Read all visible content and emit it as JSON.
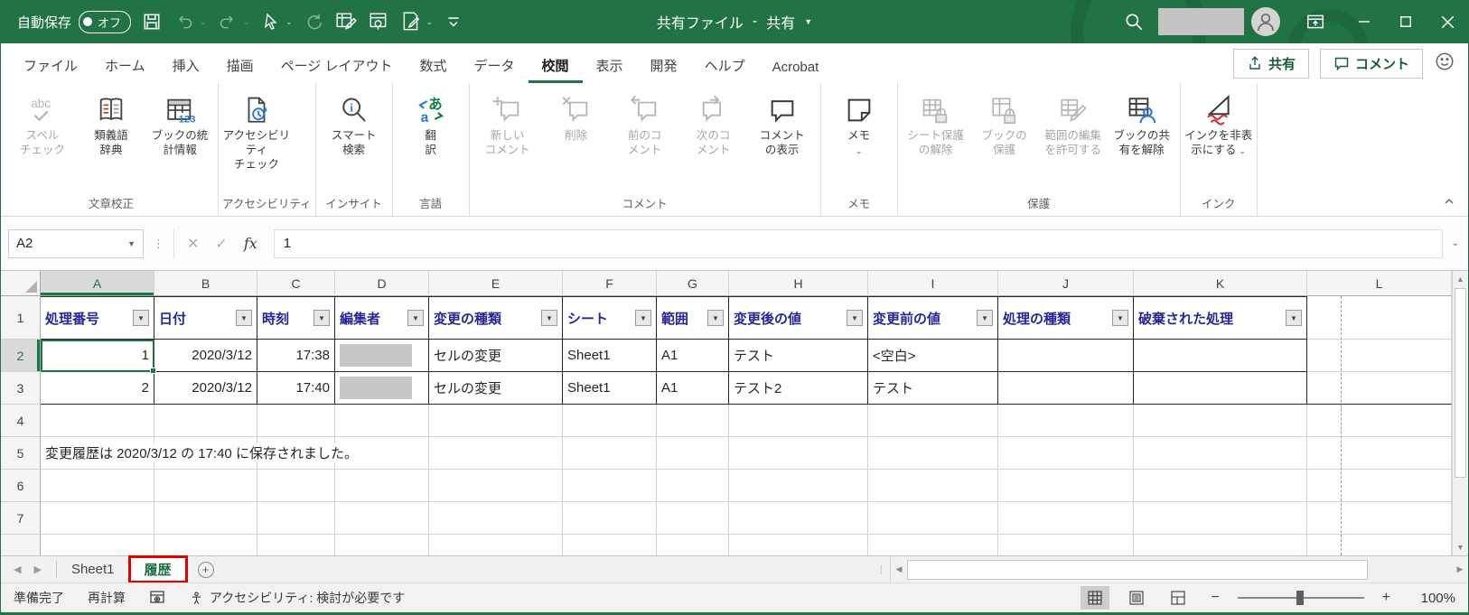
{
  "titlebar": {
    "autosave_label": "自動保存",
    "autosave_state": "オフ",
    "doc_title": "共有ファイル",
    "separator": "-",
    "doc_status": "共有"
  },
  "ribbon": {
    "tabs": [
      "ファイル",
      "ホーム",
      "挿入",
      "描画",
      "ページ レイアウト",
      "数式",
      "データ",
      "校閲",
      "表示",
      "開発",
      "ヘルプ",
      "Acrobat"
    ],
    "active_index": 7,
    "share_label": "共有",
    "comments_label": "コメント",
    "groups": [
      {
        "label": "文章校正",
        "buttons": [
          {
            "name": "spell-check",
            "icon": "spellcheck",
            "label": "スペル\nチェック",
            "disabled": true
          },
          {
            "name": "thesaurus",
            "icon": "book",
            "label": "類義語\n辞典"
          },
          {
            "name": "workbook-stats",
            "icon": "stats",
            "label": "ブックの統\n計情報"
          }
        ]
      },
      {
        "label": "アクセシビリティ",
        "buttons": [
          {
            "name": "accessibility-check",
            "icon": "accessibility",
            "label": "アクセシビリティ\nチェック"
          }
        ]
      },
      {
        "label": "インサイト",
        "buttons": [
          {
            "name": "smart-lookup",
            "icon": "lookup",
            "label": "スマート\n検索"
          }
        ]
      },
      {
        "label": "言語",
        "buttons": [
          {
            "name": "translate",
            "icon": "translate",
            "label": "翻\n訳"
          }
        ]
      },
      {
        "label": "コメント",
        "buttons": [
          {
            "name": "new-comment",
            "icon": "comment-new",
            "label": "新しい\nコメント",
            "disabled": true
          },
          {
            "name": "delete-comment",
            "icon": "comment-delete",
            "label": "削除",
            "disabled": true
          },
          {
            "name": "previous-comment",
            "icon": "comment-prev",
            "label": "前のコ\nメント",
            "disabled": true
          },
          {
            "name": "next-comment",
            "icon": "comment-next",
            "label": "次のコ\nメント",
            "disabled": true
          },
          {
            "name": "show-comments",
            "icon": "comment-show",
            "label": "コメント\nの表示"
          }
        ]
      },
      {
        "label": "メモ",
        "buttons": [
          {
            "name": "notes",
            "icon": "note",
            "label": "メモ",
            "dropdown": true
          }
        ]
      },
      {
        "label": "保護",
        "buttons": [
          {
            "name": "unprotect-sheet",
            "icon": "sheet-lock",
            "label": "シート保護\nの解除",
            "disabled": true
          },
          {
            "name": "protect-workbook",
            "icon": "book-lock",
            "label": "ブックの\n保護",
            "disabled": true
          },
          {
            "name": "allow-edit-ranges",
            "icon": "range-edit",
            "label": "範囲の編集\nを許可する",
            "disabled": true
          },
          {
            "name": "unshare-workbook",
            "icon": "unshare",
            "label": "ブックの共\n有を解除"
          }
        ]
      },
      {
        "label": "インク",
        "buttons": [
          {
            "name": "hide-ink",
            "icon": "ink",
            "label": "インクを非表\n示にする",
            "dropdown": true
          }
        ]
      }
    ]
  },
  "formula_bar": {
    "name_box": "A2",
    "formula_value": "1"
  },
  "grid": {
    "column_letters": [
      "A",
      "B",
      "C",
      "D",
      "E",
      "F",
      "G",
      "H",
      "I",
      "J",
      "K",
      "L"
    ],
    "selected_column": "A",
    "selected_cell": "A2",
    "selected_row": 2,
    "filter_headers": [
      "処理番号",
      "日付",
      "時刻",
      "編集者",
      "変更の種類",
      "シート",
      "範囲",
      "変更後の値",
      "変更前の値",
      "処理の種類",
      "破棄された処理"
    ],
    "rows": [
      {
        "cells": [
          "1",
          "2020/3/12",
          "17:38",
          "",
          "セルの変更",
          "Sheet1",
          "A1",
          "テスト",
          "<空白>",
          "",
          ""
        ],
        "redacted_col": 3
      },
      {
        "cells": [
          "2",
          "2020/3/12",
          "17:40",
          "",
          "セルの変更",
          "Sheet1",
          "A1",
          "テスト2",
          "テスト",
          "",
          ""
        ],
        "redacted_col": 3
      }
    ],
    "empty_row_numbers": [
      4,
      5,
      6,
      7
    ],
    "saved_note": "変更履歴は 2020/3/12 の 17:40 に保存されました。"
  },
  "sheet_tabs": {
    "tabs": [
      {
        "label": "Sheet1",
        "active": false,
        "highlighted": false
      },
      {
        "label": "履歴",
        "active": true,
        "highlighted": true
      }
    ]
  },
  "status_bar": {
    "mode": "準備完了",
    "calc": "再計算",
    "accessibility": "アクセシビリティ: 検討が必要です",
    "zoom_level": "100%"
  }
}
